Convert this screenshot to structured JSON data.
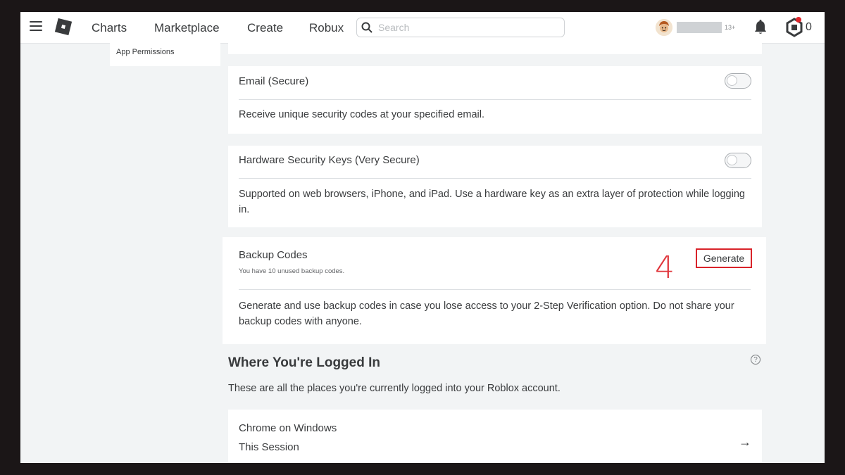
{
  "nav": {
    "links": [
      "Charts",
      "Marketplace",
      "Create",
      "Robux"
    ],
    "search_placeholder": "Search",
    "age_tag": "13+",
    "robux_count": "0"
  },
  "sidebar": {
    "items": [
      {
        "label": "App Permissions"
      }
    ]
  },
  "cards": {
    "email": {
      "title": "Email (Secure)",
      "description": "Receive unique security codes at your specified email.",
      "toggle_on": false
    },
    "hardware_keys": {
      "title": "Hardware Security Keys (Very Secure)",
      "description": "Supported on web browsers, iPhone, and iPad. Use a hardware key as an extra layer of protection while logging in.",
      "toggle_on": false
    },
    "backup_codes": {
      "title": "Backup Codes",
      "note": "You have 10 unused backup codes.",
      "button_label": "Generate",
      "description": "Generate and use backup codes in case you lose access to your 2-Step Verification option. Do not share your backup codes with anyone.",
      "step_annotation": "4"
    }
  },
  "logged_in": {
    "heading": "Where You're Logged In",
    "help_icon": "?",
    "subtitle": "These are all the places you're currently logged into your Roblox account.",
    "sessions": [
      {
        "device": "Chrome on Windows",
        "status": "This Session",
        "arrow": "→"
      }
    ]
  },
  "colors": {
    "annotation_red": "#d9232a",
    "notification_dot": "#e0252b"
  }
}
